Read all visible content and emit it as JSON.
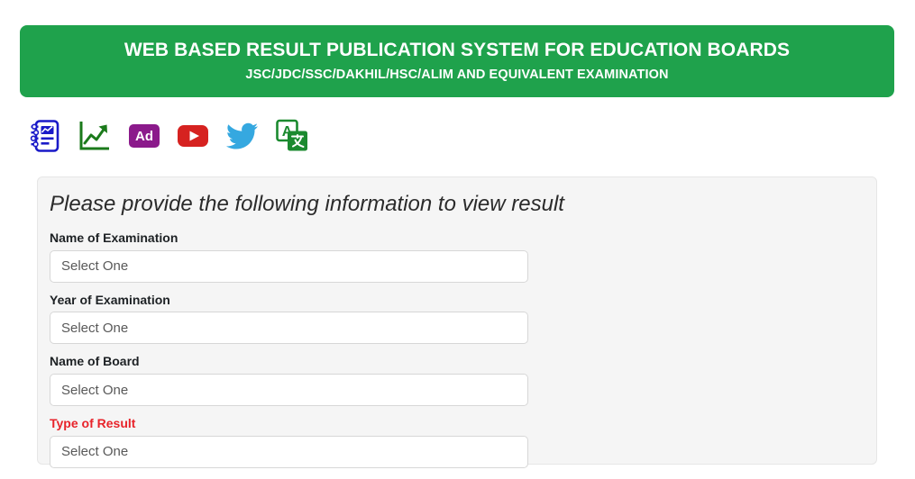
{
  "banner": {
    "title": "WEB BASED RESULT PUBLICATION SYSTEM FOR EDUCATION BOARDS",
    "subtitle": "JSC/JDC/SSC/DAKHIL/HSC/ALIM AND EQUIVALENT EXAMINATION",
    "background_color": "#1FA24C",
    "text_color": "#FFFFFF"
  },
  "icon_bar": {
    "icons": [
      {
        "name": "result-report-icon",
        "label": "Result Report",
        "color": "#1A1AC8"
      },
      {
        "name": "statistics-chart-icon",
        "label": "Statistics",
        "color": "#1B7A1B"
      },
      {
        "name": "ad-icon",
        "label": "Ad",
        "text": "Ad",
        "color": "#8B1A8B"
      },
      {
        "name": "youtube-icon",
        "label": "YouTube",
        "color": "#D62220"
      },
      {
        "name": "twitter-icon",
        "label": "Twitter",
        "color": "#35A8E0"
      },
      {
        "name": "google-translate-icon",
        "label": "Translate",
        "color": "#1B8A2F"
      }
    ]
  },
  "form": {
    "heading": "Please provide the following information to view result",
    "placeholder": "Select One",
    "required_color": "#E8232A",
    "fields": [
      {
        "label": "Name of Examination",
        "value": "Select One",
        "required": false
      },
      {
        "label": "Year of Examination",
        "value": "Select One",
        "required": false
      },
      {
        "label": "Name of Board",
        "value": "Select One",
        "required": false
      },
      {
        "label": "Type of Result",
        "value": "Select One",
        "required": true
      }
    ]
  }
}
